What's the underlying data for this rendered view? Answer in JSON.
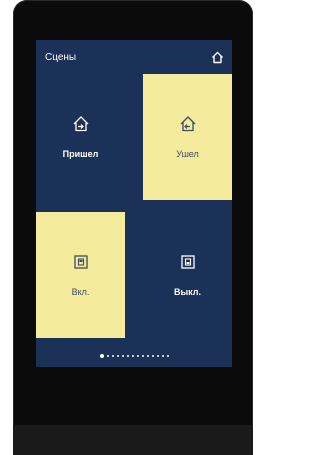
{
  "header": {
    "title": "Сцены",
    "home_icon": "home-icon"
  },
  "tiles": [
    {
      "label": "Пришел",
      "icon": "arrive-home-icon",
      "style": "dark"
    },
    {
      "label": "Ушел",
      "icon": "leave-home-icon",
      "style": "light"
    },
    {
      "label": "Вкл.",
      "icon": "switch-on-icon",
      "style": "light"
    },
    {
      "label": "Выкл.",
      "icon": "switch-off-icon",
      "style": "dark"
    }
  ],
  "pager": {
    "total_pages": 14,
    "current_page": 1
  },
  "colors": {
    "screen_background": "#1b3158",
    "tile_dark": "#1b3158",
    "tile_light": "#f4ec9c",
    "bezel": "#0b0b0c"
  }
}
